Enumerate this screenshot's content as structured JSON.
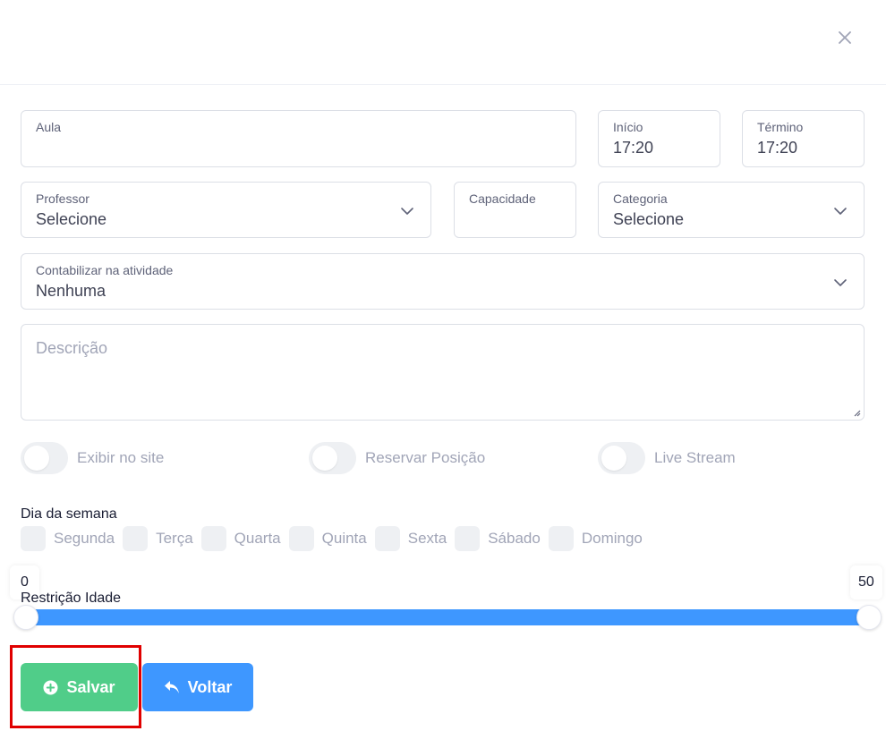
{
  "header": {
    "close_icon": "close-icon"
  },
  "form": {
    "aula": {
      "label": "Aula",
      "value": ""
    },
    "inicio": {
      "label": "Início",
      "value": "17:20"
    },
    "termino": {
      "label": "Término",
      "value": "17:20"
    },
    "professor": {
      "label": "Professor",
      "value": "Selecione"
    },
    "capacidade": {
      "label": "Capacidade",
      "value": ""
    },
    "categoria": {
      "label": "Categoria",
      "value": "Selecione"
    },
    "contabilizar": {
      "label": "Contabilizar na atividade",
      "value": "Nenhuma"
    },
    "descricao": {
      "placeholder": "Descrição",
      "value": ""
    }
  },
  "toggles": [
    {
      "label": "Exibir no site",
      "on": false
    },
    {
      "label": "Reservar Posição",
      "on": false
    },
    {
      "label": "Live Stream",
      "on": false
    }
  ],
  "weekdays": {
    "title": "Dia da semana",
    "days": [
      "Segunda",
      "Terça",
      "Quarta",
      "Quinta",
      "Sexta",
      "Sábado",
      "Domingo"
    ]
  },
  "age_restriction": {
    "title": "Restrição Idade",
    "min": "0",
    "max": "50"
  },
  "actions": {
    "save_label": "Salvar",
    "back_label": "Voltar"
  },
  "colors": {
    "save": "#50cd89",
    "back": "#3e97ff",
    "highlight": "#e00000"
  }
}
